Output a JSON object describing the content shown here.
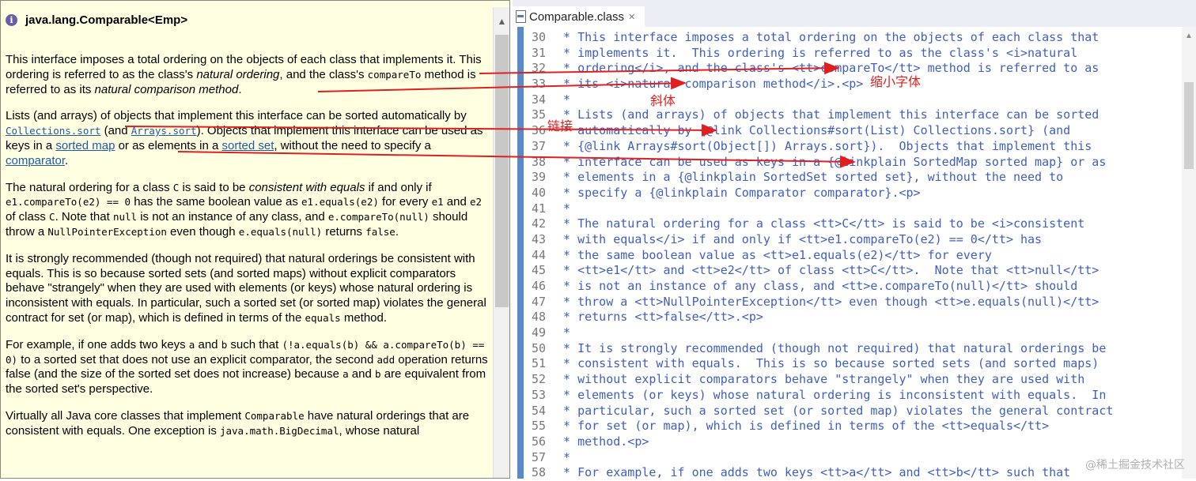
{
  "doc": {
    "title": "java.lang.Comparable<Emp>",
    "p1": {
      "t1": "This interface imposes a total ordering on the objects of each class that implements it. This ordering is referred to as the class's ",
      "em1": "natural ordering",
      "t2": ", and the class's ",
      "code1": "compareTo",
      "t3": " method is referred to as its ",
      "em2": "natural comparison method",
      "t4": "."
    },
    "p2": {
      "t1": "Lists (and arrays) of objects that implement this interface can be sorted automatically by ",
      "link1": "Collections.sort",
      "t2": " (and ",
      "link2": "Arrays.sort",
      "t3": "). Objects that implement this interface can be used as keys in a ",
      "link3": "sorted map",
      "t4": " or as elements in a ",
      "link4": "sorted set",
      "t5": ", without the need to specify a ",
      "link5": "comparator",
      "t6": "."
    },
    "p3": {
      "t1": "The natural ordering for a class ",
      "c1": "C",
      "t2": " is said to be ",
      "em1": "consistent with equals",
      "t3": " if and only if ",
      "c2": "e1.compareTo(e2) == 0",
      "t4": " has the same boolean value as ",
      "c3": "e1.equals(e2)",
      "t5": " for every ",
      "c4": "e1",
      "t6": " and ",
      "c5": "e2",
      "t7": " of class ",
      "c6": "C",
      "t8": ". Note that ",
      "c7": "null",
      "t9": " is not an instance of any class, and ",
      "c8": "e.compareTo(null)",
      "t10": " should throw a ",
      "c9": "NullPointerException",
      "t11": " even though ",
      "c10": "e.equals(null)",
      "t12": " returns ",
      "c11": "false",
      "t13": "."
    },
    "p4": {
      "t1": "It is strongly recommended (though not required) that natural orderings be consistent with equals. This is so because sorted sets (and sorted maps) without explicit comparators behave \"strangely\" when they are used with elements (or keys) whose natural ordering is inconsistent with equals. In particular, such a sorted set (or sorted map) violates the general contract for set (or map), which is defined in terms of the ",
      "c1": "equals",
      "t2": " method."
    },
    "p5": {
      "t1": "For example, if one adds two keys ",
      "c1": "a",
      "t2": " and ",
      "c2": "b",
      "t3": " such that ",
      "c3": "(!a.equals(b) && a.compareTo(b) == 0)",
      "t4": " to a sorted set that does not use an explicit comparator, the second ",
      "c4": "add",
      "t5": " operation returns false (and the size of the sorted set does not increase) because ",
      "c5": "a",
      "t6": " and ",
      "c6": "b",
      "t7": " are equivalent from the sorted set's perspective."
    },
    "p6": {
      "t1": "Virtually all Java core classes that implement ",
      "c1": "Comparable",
      "t2": " have natural orderings that are consistent with equals. One exception is ",
      "c2": "java.math.BigDecimal",
      "t3": ", whose natural"
    }
  },
  "editor": {
    "tab_label": "Comparable.class",
    "tab_close": "✕",
    "lines": [
      {
        "n": "30",
        "text": " * This interface imposes a total ordering on the objects of each class that"
      },
      {
        "n": "31",
        "text": " * implements it.  This ordering is referred to as the class's <i>natural"
      },
      {
        "n": "32",
        "text": " * ordering</i>, and the class's <tt>compareTo</tt> method is referred to as"
      },
      {
        "n": "33",
        "text": " * its <i>natural comparison method</i>.<p>"
      },
      {
        "n": "34",
        "text": " *"
      },
      {
        "n": "35",
        "text": " * Lists (and arrays) of objects that implement this interface can be sorted"
      },
      {
        "n": "36",
        "text": " * automatically by {@link Collections#sort(List) Collections.sort} (and"
      },
      {
        "n": "37",
        "text": " * {@link Arrays#sort(Object[]) Arrays.sort}).  Objects that implement this"
      },
      {
        "n": "38",
        "text": " * interface can be used as keys in a {@linkplain SortedMap sorted map} or as"
      },
      {
        "n": "39",
        "text": " * elements in a {@linkplain SortedSet sorted set}, without the need to"
      },
      {
        "n": "40",
        "text": " * specify a {@linkplain Comparator comparator}.<p>"
      },
      {
        "n": "41",
        "text": " *"
      },
      {
        "n": "42",
        "text": " * The natural ordering for a class <tt>C</tt> is said to be <i>consistent"
      },
      {
        "n": "43",
        "text": " * with equals</i> if and only if <tt>e1.compareTo(e2) == 0</tt> has"
      },
      {
        "n": "44",
        "text": " * the same boolean value as <tt>e1.equals(e2)</tt> for every"
      },
      {
        "n": "45",
        "text": " * <tt>e1</tt> and <tt>e2</tt> of class <tt>C</tt>.  Note that <tt>null</tt>"
      },
      {
        "n": "46",
        "text": " * is not an instance of any class, and <tt>e.compareTo(null)</tt> should"
      },
      {
        "n": "47",
        "text": " * throw a <tt>NullPointerException</tt> even though <tt>e.equals(null)</tt>"
      },
      {
        "n": "48",
        "text": " * returns <tt>false</tt>.<p>"
      },
      {
        "n": "49",
        "text": " *"
      },
      {
        "n": "50",
        "text": " * It is strongly recommended (though not required) that natural orderings be"
      },
      {
        "n": "51",
        "text": " * consistent with equals.  This is so because sorted sets (and sorted maps)"
      },
      {
        "n": "52",
        "text": " * without explicit comparators behave \"strangely\" when they are used with"
      },
      {
        "n": "53",
        "text": " * elements (or keys) whose natural ordering is inconsistent with equals.  In"
      },
      {
        "n": "54",
        "text": " * particular, such a sorted set (or sorted map) violates the general contract"
      },
      {
        "n": "55",
        "text": " * for set (or map), which is defined in terms of the <tt>equals</tt>"
      },
      {
        "n": "56",
        "text": " * method.<p>"
      },
      {
        "n": "57",
        "text": " *"
      },
      {
        "n": "58",
        "text": " * For example, if one adds two keys <tt>a</tt> and <tt>b</tt> such that"
      }
    ]
  },
  "annotations": {
    "shrink_font": "缩小字体",
    "italic": "斜体",
    "link": "链接",
    "color": "#e02020"
  },
  "watermark": "@稀土掘金技术社区"
}
